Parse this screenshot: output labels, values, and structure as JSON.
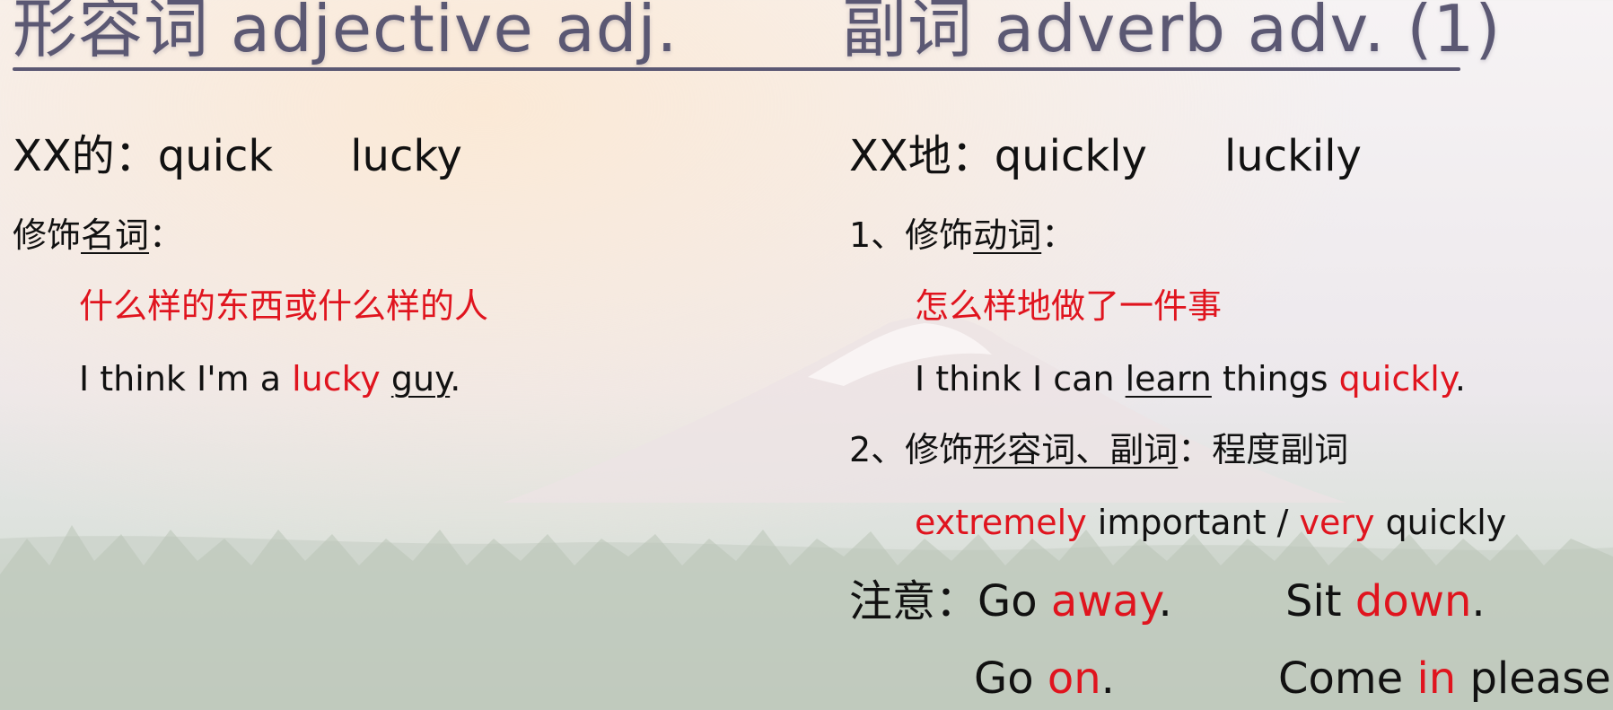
{
  "slide": {
    "title_left": "形容词  adjective  adj.",
    "title_right": "副词  adverb  adv. (1)",
    "adjective": {
      "meaning_prefix": "XX的：",
      "word1": "quick",
      "word2": "lucky",
      "modify_prefix": "修饰",
      "modify_target": "名词",
      "modify_suffix": "：",
      "explanation": "什么样的东西或什么样的人",
      "example_pre": "I think I'm a ",
      "example_adj": "lucky",
      "example_space": " ",
      "example_noun": "guy",
      "example_end": "."
    },
    "adverb": {
      "meaning_prefix": "XX地：",
      "word1": "quickly",
      "word2": "luckily",
      "rule1_prefix": "1、修饰",
      "rule1_target": "动词",
      "rule1_suffix": "：",
      "rule1_explanation": "怎么样地做了一件事",
      "rule1_example_pre": "I think I can ",
      "rule1_example_verb": "learn",
      "rule1_example_mid": " things ",
      "rule1_example_adv": "quickly",
      "rule1_example_end": ".",
      "rule2_prefix": "2、修饰",
      "rule2_target": "形容词、副词",
      "rule2_suffix": "：程度副词",
      "rule2_example_adv1": "extremely",
      "rule2_example_mid": " important / ",
      "rule2_example_adv2": "very",
      "rule2_example_end": " quickly",
      "note_label": "注意：",
      "phrases": [
        {
          "pre": "Go ",
          "adv": "away",
          "end": "."
        },
        {
          "pre": "Sit ",
          "adv": "down",
          "end": "."
        },
        {
          "pre": "Go ",
          "adv": "on",
          "end": "."
        },
        {
          "pre": "Come ",
          "adv": "in",
          "end": " please."
        }
      ]
    }
  },
  "colors": {
    "title": "#5b5873",
    "highlight": "#e0141e",
    "text": "#111111"
  }
}
